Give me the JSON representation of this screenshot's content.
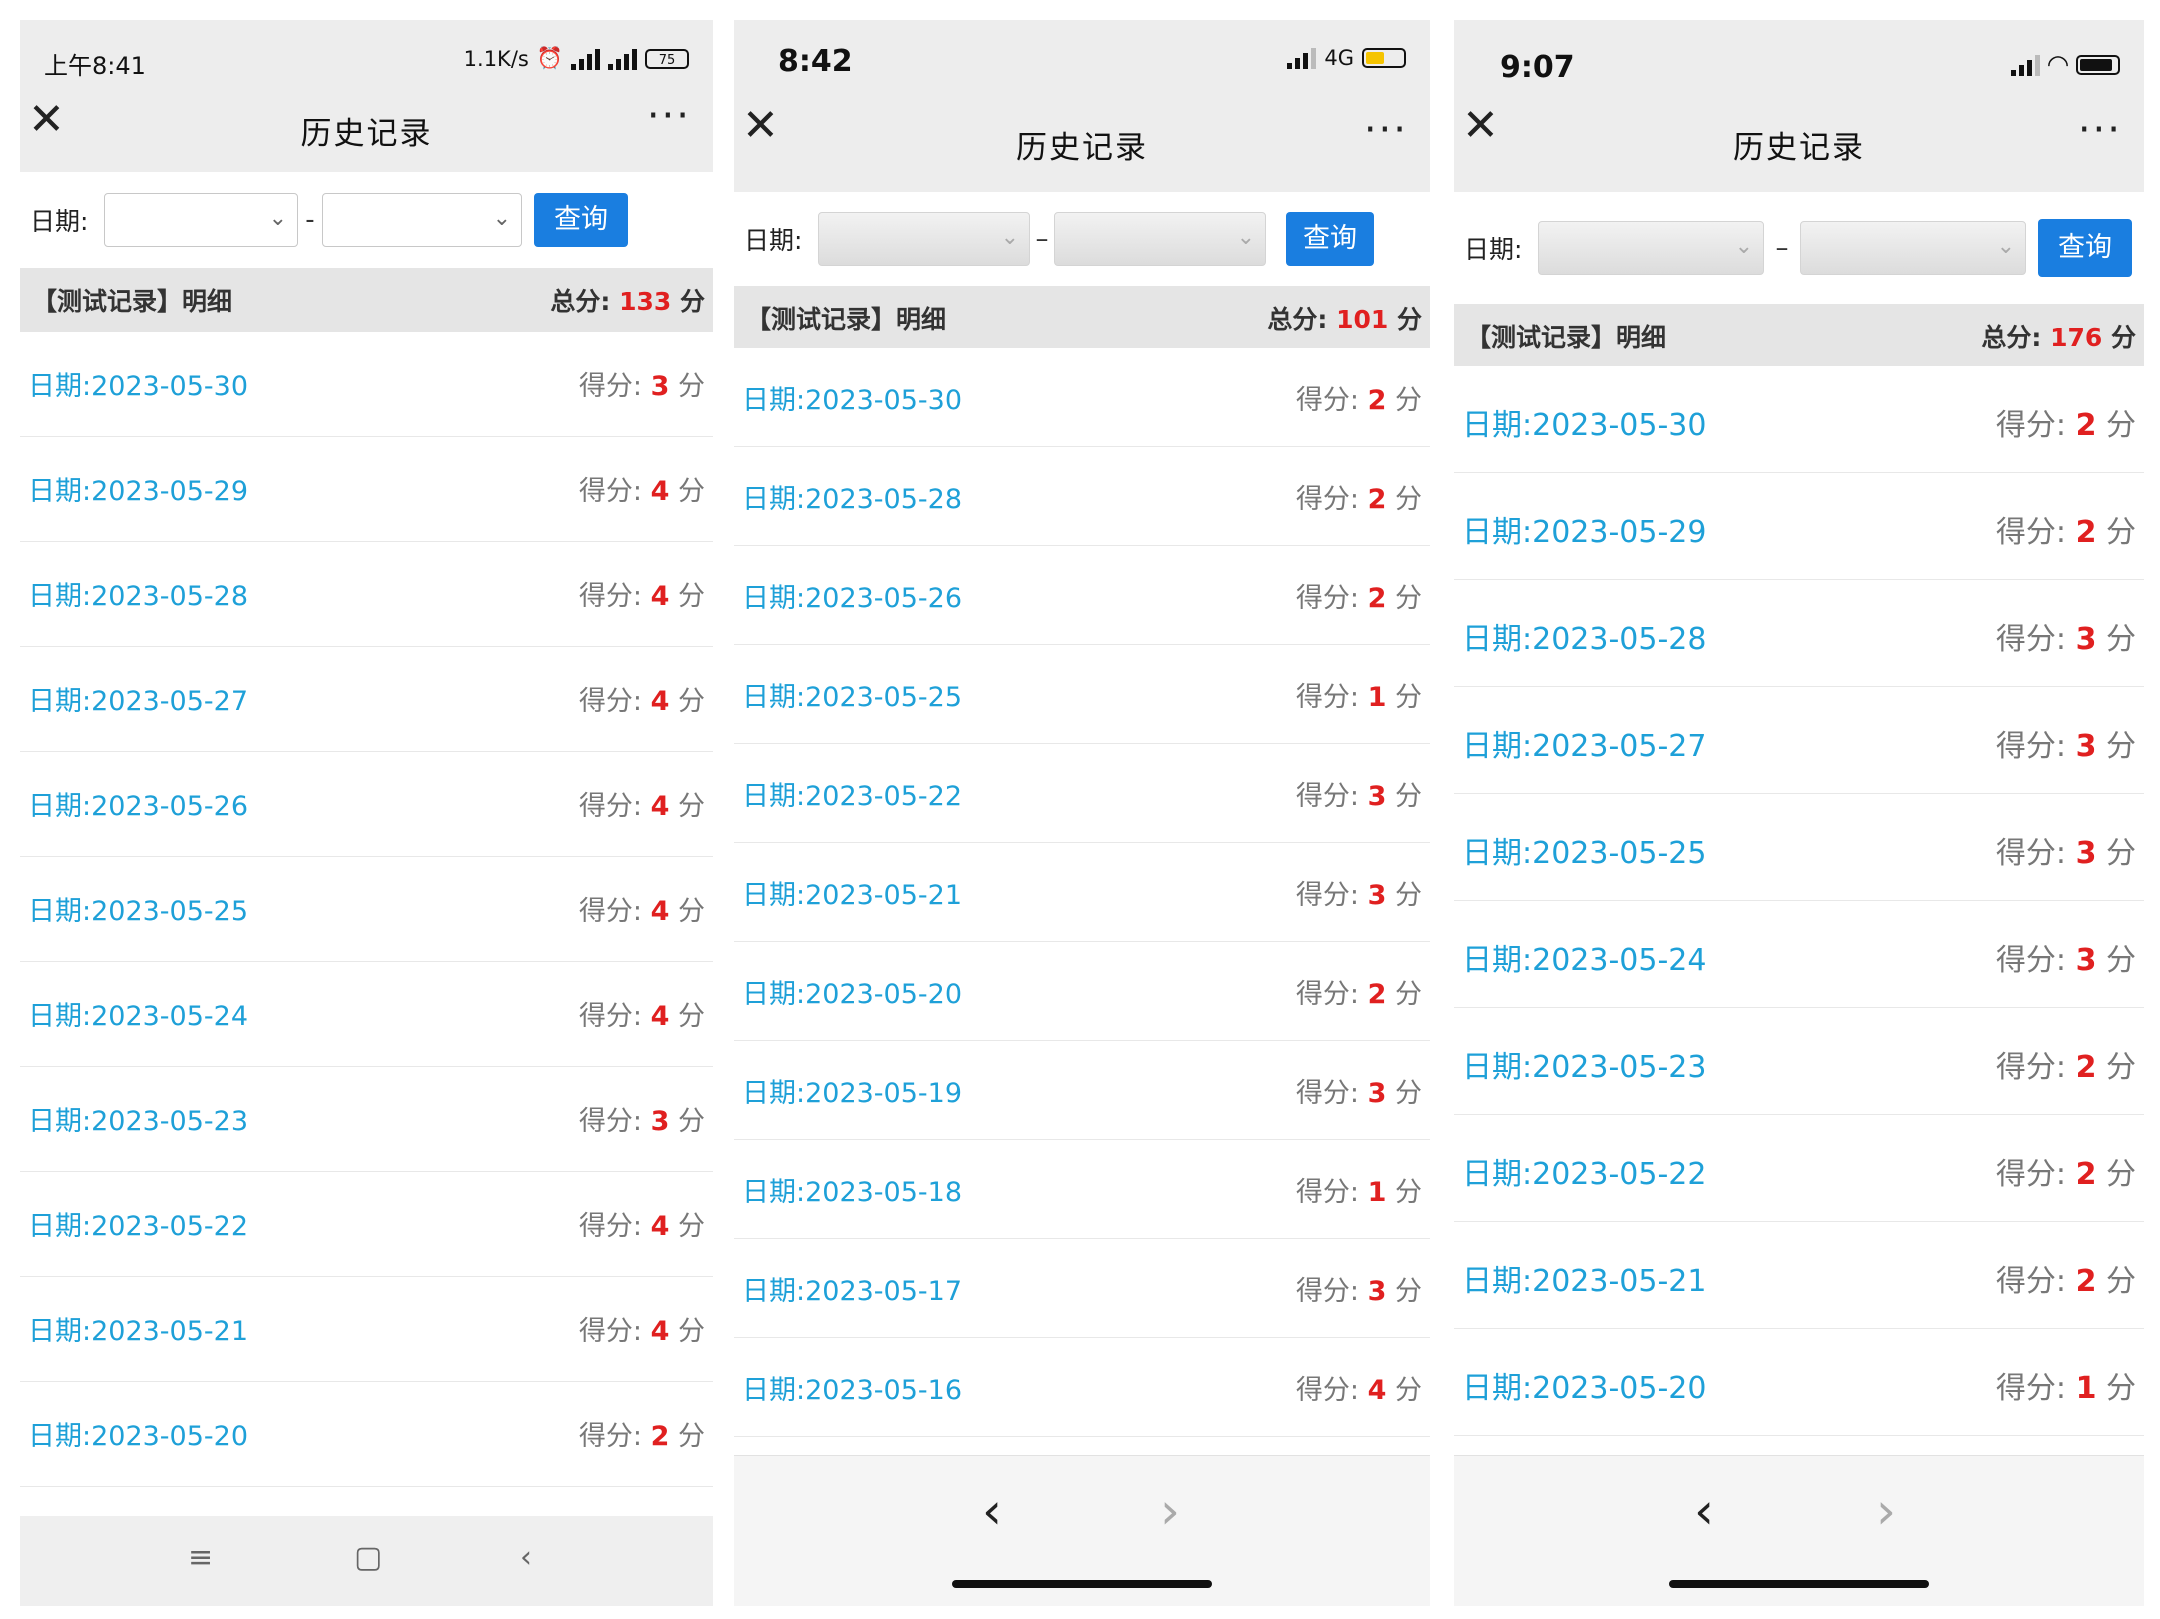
{
  "colors": {
    "link": "#1ea0d8",
    "score": "#e02020",
    "button": "#1a7ee0"
  },
  "phones": [
    {
      "status": {
        "time": "上午8:41",
        "right_text": "1.1K/s",
        "battery": "75"
      },
      "title": "历史记录",
      "filter_label": "日期:",
      "query_label": "查询",
      "summary": {
        "title": "【测试记录】明细",
        "total_label": "总分:",
        "total": "133",
        "unit": "分"
      },
      "rows": [
        {
          "date": "日期:2023-05-30",
          "score_label": "得分:",
          "score": "3",
          "unit": "分"
        },
        {
          "date": "日期:2023-05-29",
          "score_label": "得分:",
          "score": "4",
          "unit": "分"
        },
        {
          "date": "日期:2023-05-28",
          "score_label": "得分:",
          "score": "4",
          "unit": "分"
        },
        {
          "date": "日期:2023-05-27",
          "score_label": "得分:",
          "score": "4",
          "unit": "分"
        },
        {
          "date": "日期:2023-05-26",
          "score_label": "得分:",
          "score": "4",
          "unit": "分"
        },
        {
          "date": "日期:2023-05-25",
          "score_label": "得分:",
          "score": "4",
          "unit": "分"
        },
        {
          "date": "日期:2023-05-24",
          "score_label": "得分:",
          "score": "4",
          "unit": "分"
        },
        {
          "date": "日期:2023-05-23",
          "score_label": "得分:",
          "score": "3",
          "unit": "分"
        },
        {
          "date": "日期:2023-05-22",
          "score_label": "得分:",
          "score": "4",
          "unit": "分"
        },
        {
          "date": "日期:2023-05-21",
          "score_label": "得分:",
          "score": "4",
          "unit": "分"
        },
        {
          "date": "日期:2023-05-20",
          "score_label": "得分:",
          "score": "2",
          "unit": "分"
        }
      ]
    },
    {
      "status": {
        "time": "8:42",
        "right_text": "4G"
      },
      "title": "历史记录",
      "filter_label": "日期:",
      "query_label": "查询",
      "summary": {
        "title": "【测试记录】明细",
        "total_label": "总分:",
        "total": "101",
        "unit": "分"
      },
      "rows": [
        {
          "date": "日期:2023-05-30",
          "score_label": "得分:",
          "score": "2",
          "unit": "分"
        },
        {
          "date": "日期:2023-05-28",
          "score_label": "得分:",
          "score": "2",
          "unit": "分"
        },
        {
          "date": "日期:2023-05-26",
          "score_label": "得分:",
          "score": "2",
          "unit": "分"
        },
        {
          "date": "日期:2023-05-25",
          "score_label": "得分:",
          "score": "1",
          "unit": "分"
        },
        {
          "date": "日期:2023-05-22",
          "score_label": "得分:",
          "score": "3",
          "unit": "分"
        },
        {
          "date": "日期:2023-05-21",
          "score_label": "得分:",
          "score": "3",
          "unit": "分"
        },
        {
          "date": "日期:2023-05-20",
          "score_label": "得分:",
          "score": "2",
          "unit": "分"
        },
        {
          "date": "日期:2023-05-19",
          "score_label": "得分:",
          "score": "3",
          "unit": "分"
        },
        {
          "date": "日期:2023-05-18",
          "score_label": "得分:",
          "score": "1",
          "unit": "分"
        },
        {
          "date": "日期:2023-05-17",
          "score_label": "得分:",
          "score": "3",
          "unit": "分"
        },
        {
          "date": "日期:2023-05-16",
          "score_label": "得分:",
          "score": "4",
          "unit": "分"
        }
      ]
    },
    {
      "status": {
        "time": "9:07"
      },
      "title": "历史记录",
      "filter_label": "日期:",
      "query_label": "查询",
      "summary": {
        "title": "【测试记录】明细",
        "total_label": "总分:",
        "total": "176",
        "unit": "分"
      },
      "rows": [
        {
          "date": "日期:2023-05-30",
          "score_label": "得分:",
          "score": "2",
          "unit": "分"
        },
        {
          "date": "日期:2023-05-29",
          "score_label": "得分:",
          "score": "2",
          "unit": "分"
        },
        {
          "date": "日期:2023-05-28",
          "score_label": "得分:",
          "score": "3",
          "unit": "分"
        },
        {
          "date": "日期:2023-05-27",
          "score_label": "得分:",
          "score": "3",
          "unit": "分"
        },
        {
          "date": "日期:2023-05-25",
          "score_label": "得分:",
          "score": "3",
          "unit": "分"
        },
        {
          "date": "日期:2023-05-24",
          "score_label": "得分:",
          "score": "3",
          "unit": "分"
        },
        {
          "date": "日期:2023-05-23",
          "score_label": "得分:",
          "score": "2",
          "unit": "分"
        },
        {
          "date": "日期:2023-05-22",
          "score_label": "得分:",
          "score": "2",
          "unit": "分"
        },
        {
          "date": "日期:2023-05-21",
          "score_label": "得分:",
          "score": "2",
          "unit": "分"
        },
        {
          "date": "日期:2023-05-20",
          "score_label": "得分:",
          "score": "1",
          "unit": "分"
        }
      ]
    }
  ]
}
